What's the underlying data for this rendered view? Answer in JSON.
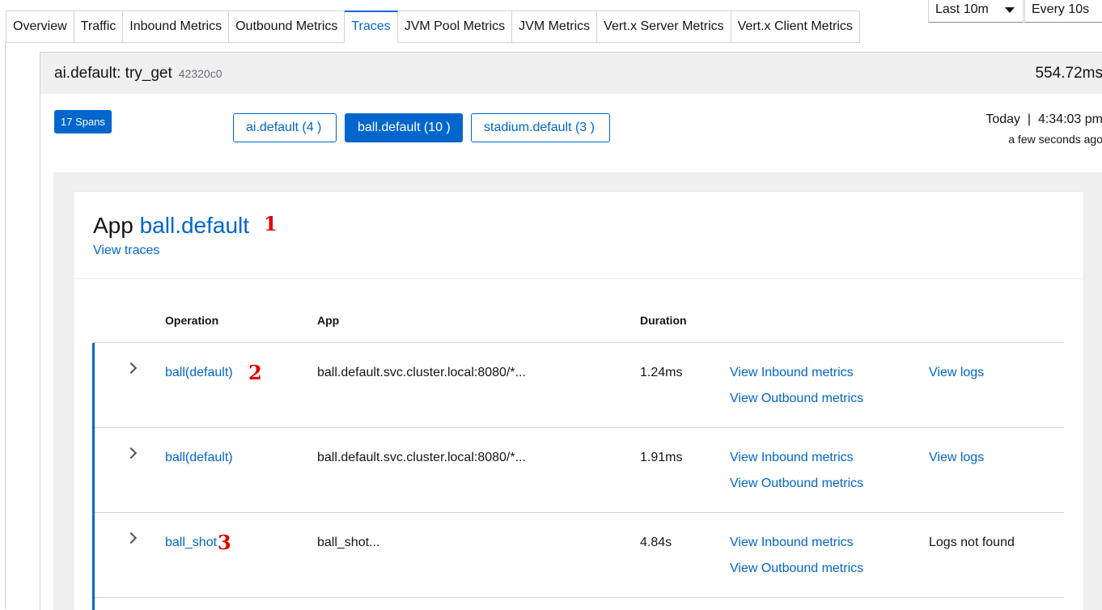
{
  "tabs": [
    {
      "label": "Overview"
    },
    {
      "label": "Traffic"
    },
    {
      "label": "Inbound Metrics"
    },
    {
      "label": "Outbound Metrics"
    },
    {
      "label": "Traces",
      "active": true
    },
    {
      "label": "JVM Pool Metrics"
    },
    {
      "label": "JVM Metrics"
    },
    {
      "label": "Vert.x Server Metrics"
    },
    {
      "label": "Vert.x Client Metrics"
    }
  ],
  "controls": {
    "range": "Last 10m",
    "refresh": "Every 10s"
  },
  "trace": {
    "title": "ai.default: try_get",
    "id": "42320c0",
    "duration": "554.72ms",
    "spans_badge": "17 Spans",
    "app_buttons": [
      "ai.default (4 )",
      "ball.default (10 )",
      "stadium.default (3 )"
    ],
    "date": "Today  |  4:34:03 pm",
    "relative_time": "a few seconds ago"
  },
  "app_card": {
    "prefix": "App",
    "name": "ball.default",
    "view_traces": "View traces",
    "columns": {
      "operation": "Operation",
      "app": "App",
      "duration": "Duration"
    },
    "rows": [
      {
        "operation": "ball(default)",
        "app": "ball.default.svc.cluster.local:8080/*...",
        "duration": "1.24ms",
        "inbound": "View Inbound metrics",
        "outbound": "View Outbound metrics",
        "logs": "View logs"
      },
      {
        "operation": "ball(default)",
        "app": "ball.default.svc.cluster.local:8080/*...",
        "duration": "1.91ms",
        "inbound": "View Inbound metrics",
        "outbound": "View Outbound metrics",
        "logs": "View logs"
      },
      {
        "operation": "ball_shot",
        "app": "ball_shot...",
        "duration": "4.84s",
        "inbound": "View Inbound metrics",
        "outbound": "View Outbound metrics",
        "logs_missing": "Logs not found"
      }
    ]
  },
  "annotations": [
    "1",
    "2",
    "3"
  ],
  "colors": {
    "accent": "#0066cc",
    "annotation": "#e00000",
    "header_bg": "#f0f0f0"
  }
}
